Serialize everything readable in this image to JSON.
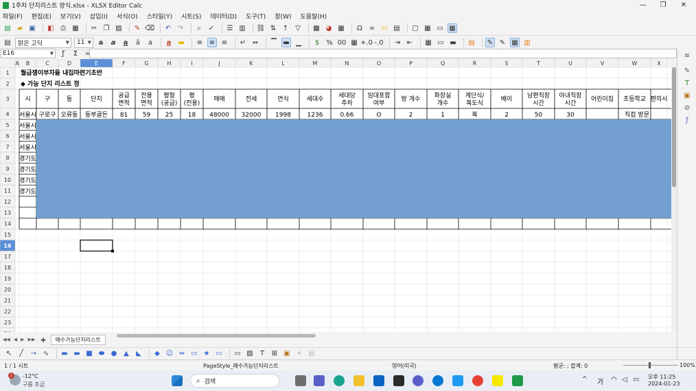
{
  "window": {
    "title": "1주차 단지리스트 양식.xlsx - XLSX Editor Calc",
    "minimize": "—",
    "maximize": "❐",
    "close": "✕"
  },
  "menu": [
    "파일(F)",
    "편집(E)",
    "보기(V)",
    "삽입(I)",
    "서식(O)",
    "스타일(Y)",
    "시트(S)",
    "데이터(D)",
    "도구(T)",
    "창(W)",
    "도움말(H)"
  ],
  "format": {
    "font_name": "맑은 고딕",
    "font_size": "11"
  },
  "formula": {
    "cell_ref": "E16",
    "value": ""
  },
  "sheet": {
    "columns": [
      "A",
      "B",
      "C",
      "D",
      "E",
      "F",
      "G",
      "H",
      "I",
      "J",
      "K",
      "L",
      "M",
      "N",
      "O",
      "P",
      "Q",
      "R",
      "S",
      "T",
      "U",
      "V",
      "W",
      "X"
    ],
    "row_numbers": [
      "1",
      "2",
      "3",
      "4",
      "5",
      "6",
      "7",
      "8",
      "9",
      "10",
      "11",
      "12",
      "13",
      "14",
      "15",
      "16",
      "17",
      "18",
      "19",
      "20",
      "21",
      "22",
      "23",
      "24"
    ],
    "title": "월급쟁이부자들 내집마련기초반",
    "subtitle": "◆ 가능 단지 리스트 정",
    "headers": [
      [
        "시"
      ],
      [
        "구"
      ],
      [
        "동"
      ],
      [
        "단지"
      ],
      [
        "공급",
        "면적"
      ],
      [
        "전용",
        "면적"
      ],
      [
        "평형",
        "(공급)"
      ],
      [
        "평",
        "(전용)"
      ],
      [
        "매매"
      ],
      [
        "전세"
      ],
      [
        "연식"
      ],
      [
        "세대수"
      ],
      [
        "세대당",
        "주차"
      ],
      [
        "임대포함",
        "여부"
      ],
      [
        "방 개수"
      ],
      [
        "화장실",
        "개수"
      ],
      [
        "계단식/",
        "복도식"
      ],
      [
        "베이"
      ],
      [
        "남편직장",
        "시간"
      ],
      [
        "아내직장",
        "시간"
      ],
      [
        "어린이집"
      ],
      [
        "초등학교"
      ],
      [
        "편의시"
      ]
    ],
    "row4": [
      "서울시",
      "구로구",
      "오류동",
      "동부골든",
      "81",
      "59",
      "25",
      "18",
      "48000",
      "32000",
      "1998",
      "1236",
      "0.66",
      "O",
      "2",
      "1",
      "복",
      "2",
      "50",
      "30",
      "",
      "직접 방문"
    ],
    "col_b_rows": [
      "서울시",
      "서울시",
      "서울시",
      "경기도",
      "경기도",
      "경기도",
      "경기도"
    ],
    "selected_cell": "E16",
    "colors": {
      "fill_block": "#729fcf",
      "selected_header": "#5b8fd6",
      "cell_border": "#000000"
    }
  },
  "tabs": {
    "add": "+",
    "sheet_name": "매수가능단지리스트"
  },
  "status": {
    "sheet_index": "1 / 1 시트",
    "page_style": "PageStyle_매수가능단지리스트",
    "language": "영어(미국)",
    "summary": "평균: ; 합계: 0",
    "zoom": "100%"
  },
  "taskbar": {
    "weather_temp": "-12°C",
    "weather_desc": "구름 조금",
    "search_label": "검색",
    "ime": "가",
    "time": "오후 11:25",
    "date": "2024-01-23",
    "notification_count": "1"
  }
}
